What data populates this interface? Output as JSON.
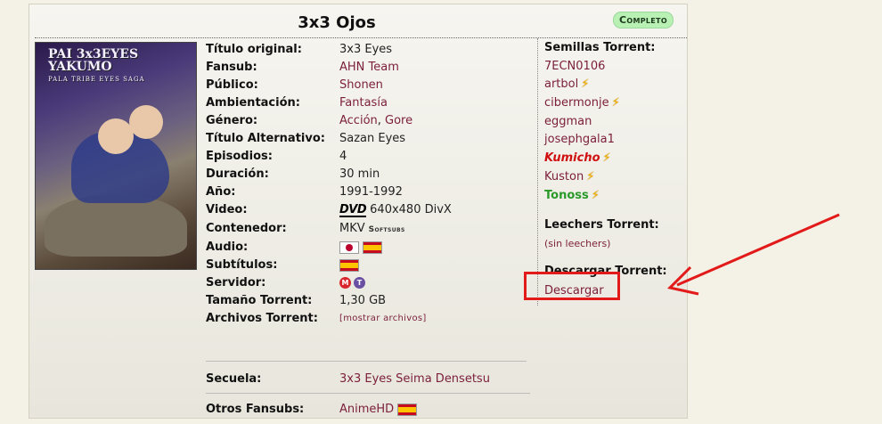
{
  "title": "3x3 Ojos",
  "status_badge": "Completo",
  "cover": {
    "logo_line1": "PAI 3x3EYES YAKUMO",
    "logo_line2": "PALA TRIBE  EYES SAGA"
  },
  "info": {
    "titulo_original": {
      "label": "Título original:",
      "value": "3x3 Eyes"
    },
    "fansub": {
      "label": "Fansub:",
      "value": "AHN Team"
    },
    "publico": {
      "label": "Público:",
      "value": "Shonen"
    },
    "ambientacion": {
      "label": "Ambientación:",
      "value": "Fantasía"
    },
    "genero": {
      "label": "Género:",
      "value1": "Acción",
      "sep": ", ",
      "value2": "Gore"
    },
    "titulo_alternativo": {
      "label": "Título Alternativo:",
      "value": "Sazan Eyes"
    },
    "episodios": {
      "label": "Episodios:",
      "value": "4"
    },
    "duracion": {
      "label": "Duración:",
      "value": "30 min"
    },
    "anio": {
      "label": "Año:",
      "value": "1991-1992"
    },
    "video": {
      "label": "Video:",
      "dvd": "DVD",
      "value": "640x480 DivX"
    },
    "contenedor": {
      "label": "Contenedor:",
      "value": "MKV",
      "extra": "Softsubs"
    },
    "audio": {
      "label": "Audio:"
    },
    "subtitulos": {
      "label": "Subtítulos:"
    },
    "servidor": {
      "label": "Servidor:",
      "s1": "M",
      "s2": "T"
    },
    "tamano": {
      "label": "Tamaño Torrent:",
      "value": "1,30 GB"
    },
    "archivos": {
      "label": "Archivos Torrent:",
      "value": "[mostrar archivos]"
    },
    "secuela": {
      "label": "Secuela:",
      "value": "3x3 Eyes Seima Densetsu"
    },
    "otros": {
      "label": "Otros Fansubs:",
      "value": "AnimeHD"
    }
  },
  "side": {
    "semillas_head": "Semillas Torrent:",
    "seeders": [
      "7ECN0106",
      "artbol",
      "cibermonje",
      "eggman",
      "josephgala1",
      "Kumicho",
      "Kuston",
      "Tonoss"
    ],
    "bolt": "⚡",
    "leechers_head": "Leechers Torrent:",
    "leechers_none": "(sin leechers)",
    "descargar_head": "Descargar Torrent:",
    "descargar_link": "Descargar"
  },
  "colors": {
    "link": "#7b1e3a",
    "highlight": "#e21a1a",
    "badge": "#b9f0b4"
  }
}
